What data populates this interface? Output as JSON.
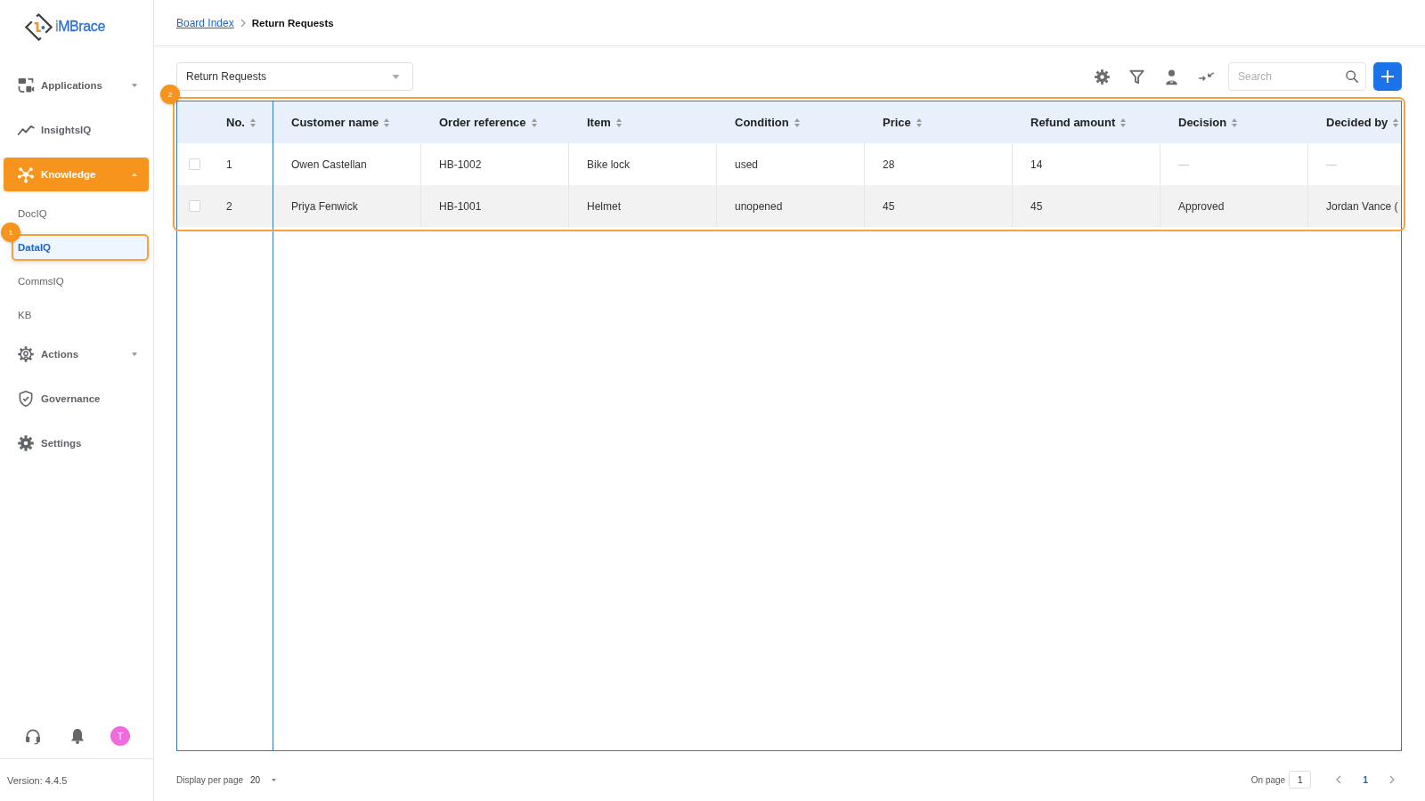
{
  "sidebar": {
    "logo": "iMBrace",
    "items": [
      {
        "label": "Applications",
        "kind": "group",
        "expanded": false,
        "selected": false
      },
      {
        "label": "InsightsIQ",
        "kind": "link",
        "selected": false
      },
      {
        "label": "Knowledge",
        "kind": "group",
        "expanded": true,
        "selected": true,
        "children": [
          {
            "label": "DocIQ",
            "selected": false
          },
          {
            "label": "DataIQ",
            "selected": true,
            "tour_step": "1"
          },
          {
            "label": "CommsIQ",
            "selected": false
          },
          {
            "label": "KB",
            "selected": false
          }
        ]
      },
      {
        "label": "Actions",
        "kind": "group",
        "expanded": false,
        "selected": false
      },
      {
        "label": "Governance",
        "kind": "link",
        "selected": false
      },
      {
        "label": "Settings",
        "kind": "link",
        "selected": false
      }
    ],
    "avatar_initial": "T",
    "version": "Version: 4.4.5"
  },
  "breadcrumb": [
    {
      "label": "Board Index",
      "kind": "link"
    },
    {
      "label": "Return Requests",
      "kind": "current"
    }
  ],
  "toolbar": {
    "board_select": {
      "value": "Return Requests"
    },
    "search": {
      "placeholder": "Search"
    }
  },
  "table": {
    "tour_step": "2",
    "columns": [
      "No.",
      "Customer name",
      "Order reference",
      "Item",
      "Condition",
      "Price",
      "Refund amount",
      "Decision",
      "Decided by"
    ],
    "rows": [
      {
        "checked": false,
        "cells": [
          {
            "text": "1",
            "muted": false
          },
          {
            "text": "Owen Castellan",
            "muted": false
          },
          {
            "text": "HB-1002",
            "muted": false
          },
          {
            "text": "Bike lock",
            "muted": false
          },
          {
            "text": "used",
            "muted": false
          },
          {
            "text": "28",
            "muted": false
          },
          {
            "text": "14",
            "muted": false
          },
          {
            "text": "—",
            "muted": true
          },
          {
            "text": "—",
            "muted": true
          }
        ]
      },
      {
        "checked": false,
        "cells": [
          {
            "text": "2",
            "muted": false
          },
          {
            "text": "Priya Fenwick",
            "muted": false
          },
          {
            "text": "HB-1001",
            "muted": false
          },
          {
            "text": "Helmet",
            "muted": false
          },
          {
            "text": "unopened",
            "muted": false
          },
          {
            "text": "45",
            "muted": false
          },
          {
            "text": "45",
            "muted": false
          },
          {
            "text": "Approved",
            "muted": false
          },
          {
            "text": "Jordan Vance (",
            "muted": false
          }
        ]
      }
    ]
  },
  "pagination": {
    "per_page_label": "Display per page",
    "per_page": "20",
    "on_page_label": "On page",
    "current_page": "1",
    "pages": [
      {
        "label": "1",
        "selected": true
      }
    ]
  }
}
